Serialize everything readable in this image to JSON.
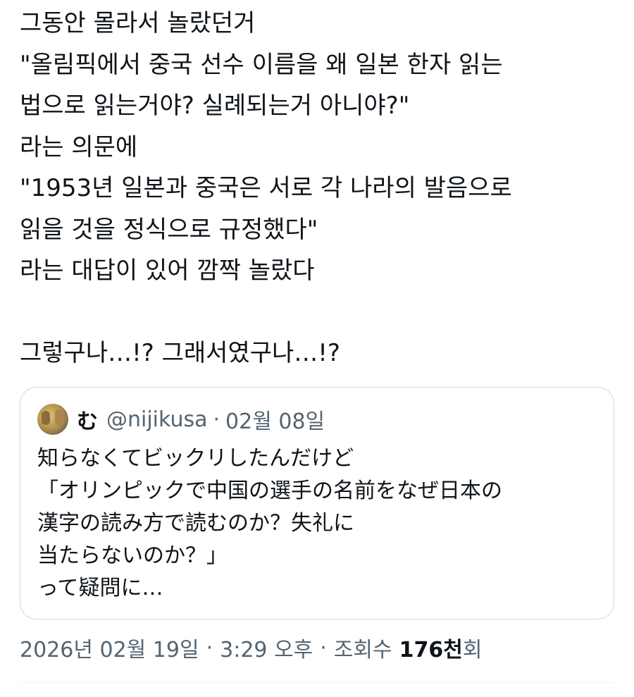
{
  "tweet": {
    "lines": [
      "그동안 몰라서 놀랐던거",
      "\"올림픽에서 중국 선수 이름을 왜 일본 한자 읽는",
      "법으로 읽는거야? 실례되는거 아니야?\"",
      "라는 의문에",
      "\"1953년 일본과 중국은 서로 각 나라의 발음으로",
      "읽을 것을 정식으로 규정했다\"",
      "라는 대답이 있어 깜짝 놀랐다",
      "",
      "그렇구나…!? 그래서였구나…!?"
    ]
  },
  "quote": {
    "avatar_icon": "user-avatar-photo",
    "author_name": "む",
    "author_handle": "@nijikusa",
    "separator": "·",
    "date": "02월 08일",
    "lines": [
      "知らなくてビックリしたんだけど",
      "「オリンピックで中国の選手の名前をなぜ日本の",
      "漢字の読み方で読むのか？失礼に",
      "当たらないのか？」",
      "って疑問に…"
    ]
  },
  "meta": {
    "date": "2026년 02월 19일",
    "separator": "·",
    "time": "3:29 오후",
    "views_label": "조회수",
    "views_count": "176천",
    "views_suffix": "회"
  },
  "colors": {
    "text": "#0f1419",
    "secondary": "#536471",
    "border": "#cfd9de"
  }
}
